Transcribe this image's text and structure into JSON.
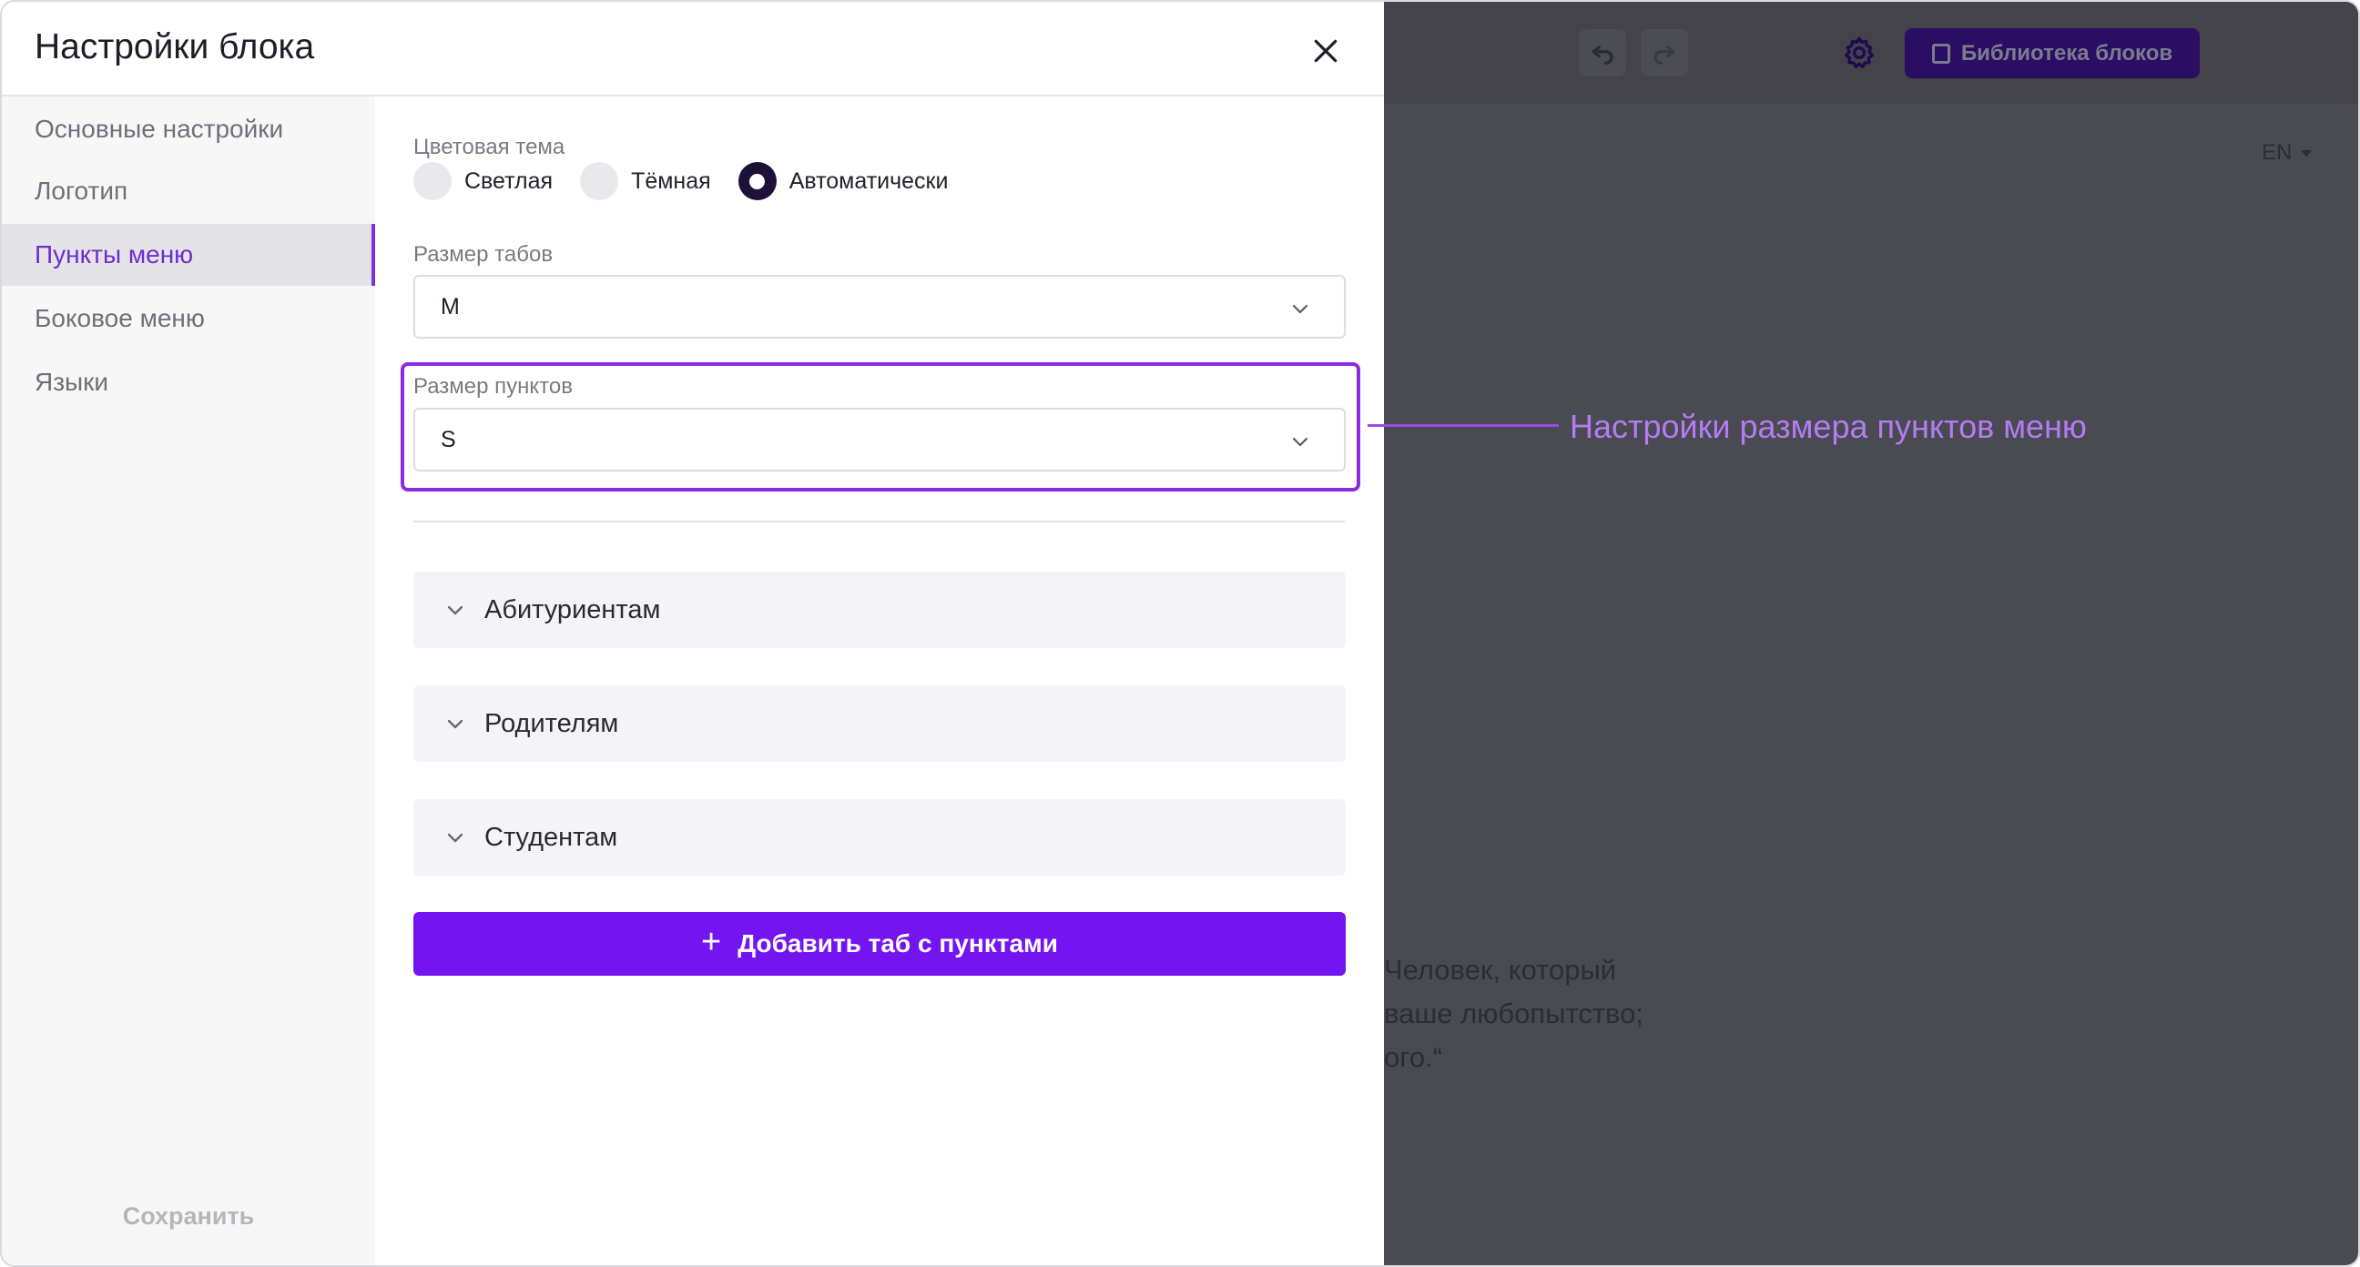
{
  "modal": {
    "title": "Настройки блока",
    "sidebar": {
      "items": [
        {
          "label": "Основные настройки"
        },
        {
          "label": "Логотип"
        },
        {
          "label": "Пункты меню"
        },
        {
          "label": "Боковое меню"
        },
        {
          "label": "Языки"
        }
      ],
      "active_index": 2,
      "save_label": "Сохранить"
    },
    "color_theme": {
      "label": "Цветовая тема",
      "options": [
        {
          "label": "Светлая"
        },
        {
          "label": "Тёмная"
        },
        {
          "label": "Автоматически"
        }
      ],
      "selected": "Автоматически"
    },
    "tab_size": {
      "label": "Размер табов",
      "value": "M"
    },
    "item_size": {
      "label": "Размер пунктов",
      "value": "S"
    },
    "tabs": [
      {
        "label": "Абитуриентам"
      },
      {
        "label": "Родителям"
      },
      {
        "label": "Студентам"
      }
    ],
    "add_tab_label": "Добавить таб с пунктами"
  },
  "background": {
    "library_button": "Библиотека блоков",
    "language": "EN",
    "quote": "Человек, который\nваше любопытство;\nого.“"
  },
  "annotation": {
    "text": "Настройки размера пунктов меню"
  },
  "colors": {
    "accent": "#7414f0",
    "highlight": "#8a2be2",
    "annotation": "#b47cf2",
    "overlay": "#4a4a52"
  }
}
